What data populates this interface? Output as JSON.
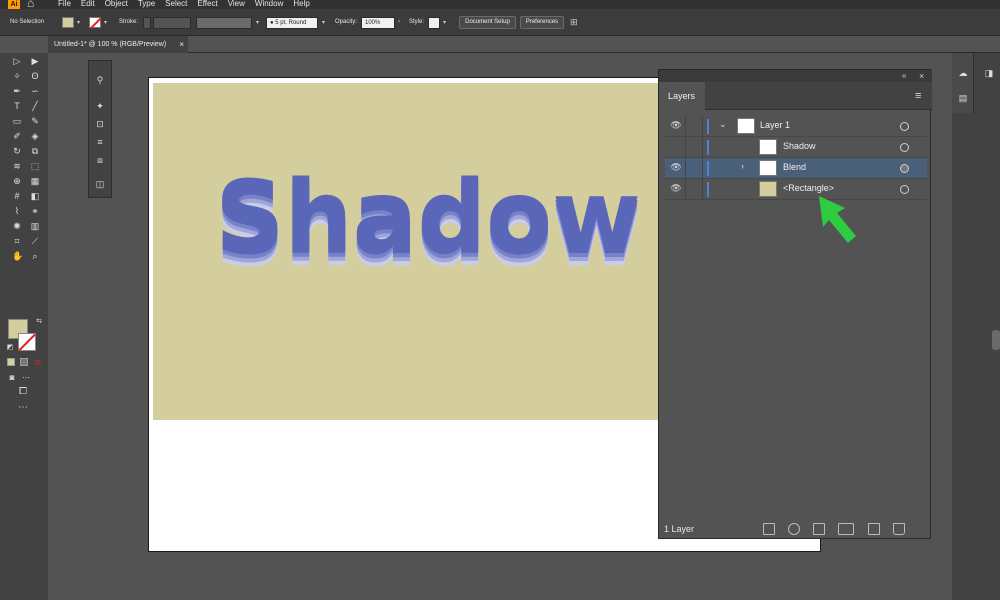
{
  "menubar": {
    "app_badge": "Ai",
    "items": [
      "File",
      "Edit",
      "Object",
      "Type",
      "Select",
      "Effect",
      "View",
      "Window",
      "Help"
    ]
  },
  "control_bar": {
    "selection": "No Selection",
    "stroke_label": "Stroke:",
    "brush": "5 pt. Round",
    "opacity_label": "Opacity:",
    "opacity_value": "100%",
    "style_label": "Style:",
    "document_setup": "Document Setup",
    "preferences": "Preferences",
    "fill_color": "#d4cd9d"
  },
  "document_tab": {
    "title": "Untitled-1* @ 100 % (RGB/Preview)",
    "close": "×"
  },
  "artboard": {
    "rectangle_color": "#d4cd9d",
    "text": "Shadow",
    "text_color": "#5a66b8"
  },
  "layers_panel": {
    "tab": "Layers",
    "rows": [
      {
        "name": "Layer 1",
        "expanded": true,
        "selected": false
      },
      {
        "name": "Shadow",
        "expanded": false,
        "selected": false
      },
      {
        "name": "Blend",
        "expanded": false,
        "selected": true
      },
      {
        "name": "<Rectangle>",
        "expanded": false,
        "selected": false
      }
    ],
    "footer_count": "1 Layer",
    "accent_color": "#4f7fe0"
  },
  "annotation": {
    "arrow_color": "#2ecc40"
  }
}
